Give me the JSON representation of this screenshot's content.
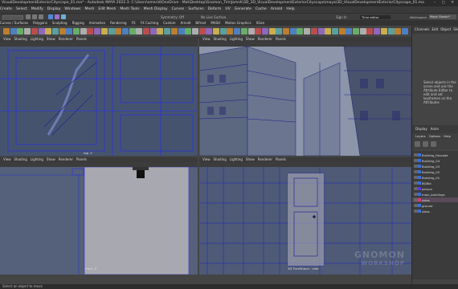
{
  "window": {
    "title": "VisualDevelopmentExteriorCityscape_01.ma* - Autodesk MAYA 2022.3: C:\\Users\\emerid\\OneDrive - Mat\\Desktop\\Gnomon_Tim\\Jamsh\\3D_3D_VisualDevelopmentExteriorCityscape\\maya\\3D_VisualDevelopmentExteriorCityscape_01.ma"
  },
  "menus": [
    "Create",
    "Select",
    "Modify",
    "Display",
    "Windows",
    "Mesh",
    "Edit Mesh",
    "Mesh Tools",
    "Mesh Display",
    "Curves",
    "Surfaces",
    "Deform",
    "UV",
    "Generate",
    "Cache",
    "Arnold",
    "Help"
  ],
  "status": {
    "no_live_surface": "No Live Surface",
    "symmetry": "Symmetry: Off",
    "sign_in": "Sign In",
    "workspace_label": "Workspace:",
    "workspace_value": "Maya Classic*",
    "time_editor": "Time editor"
  },
  "shelf_tabs": [
    "Curves / Surfaces",
    "Polygons",
    "Sculpting",
    "Rigging",
    "Animation",
    "Rendering",
    "FX",
    "FX Caching",
    "Custom",
    "Arnold",
    "Bifrost",
    "MASH",
    "Motion Graphics",
    "XGen"
  ],
  "viewport_menus": [
    "View",
    "Shading",
    "Lighting",
    "Show",
    "Renderer",
    "Panels"
  ],
  "viewports": {
    "top_left_label": "top -Y",
    "top_right_label": "",
    "bottom_left_label": "front -Z",
    "bottom_right_label": "3D PureShaun : side"
  },
  "right_panel": {
    "tabs": [
      "Channels",
      "Edit",
      "Object",
      "Show"
    ],
    "hint": "Select objects in the scene and use the Attribute Editor to edit and set keyframes on the Attributes",
    "display_tabs": [
      "Display",
      "Anim"
    ],
    "layers_menu": [
      "Layers",
      "Options",
      "Help"
    ],
    "outliner": [
      {
        "name": "Building_Fascade",
        "color": "#3a6fd8"
      },
      {
        "name": "Building_04",
        "color": "#3a6fd8"
      },
      {
        "name": "Building_03",
        "color": "#3a6fd8"
      },
      {
        "name": "Building_02",
        "color": "#3a6fd8"
      },
      {
        "name": "Building_01",
        "color": "#3a6fd8"
      },
      {
        "name": "BGBld",
        "color": "#3a6fd8"
      },
      {
        "name": "person",
        "color": "#5a3ad8"
      },
      {
        "name": "main_buildings",
        "color": "#3a6fd8"
      },
      {
        "name": "sides",
        "color": "#d83a6f"
      },
      {
        "name": "ground",
        "color": "#3a6fd8"
      },
      {
        "name": "sides",
        "color": "#3a6fd8"
      }
    ]
  },
  "bottom": {
    "status_text": "Select an object to move"
  },
  "logo": {
    "line1": "GNOMON",
    "line2": "WORKSHOP"
  }
}
